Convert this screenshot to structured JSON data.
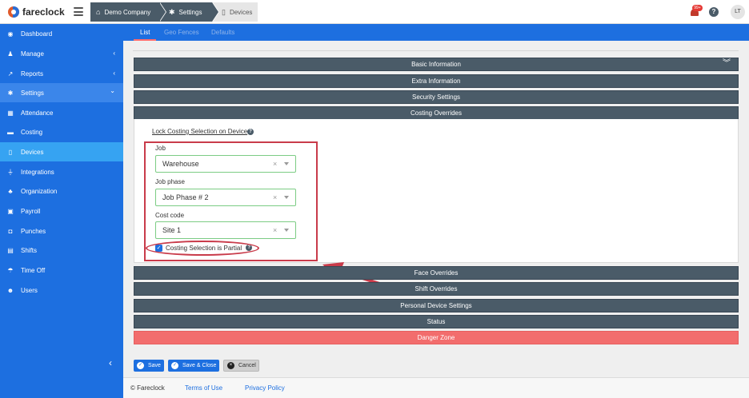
{
  "app": {
    "logo_text": "fareclock"
  },
  "breadcrumb": [
    {
      "label": "Demo Company",
      "icon": "home-icon"
    },
    {
      "label": "Settings",
      "icon": "gear-icon"
    },
    {
      "label": "Devices",
      "icon": "device-icon"
    }
  ],
  "header": {
    "notification_count": "99+",
    "help_icon": "?",
    "avatar_initials": "LT"
  },
  "sidebar": {
    "items": [
      {
        "label": "Dashboard",
        "icon": "dashboard-icon"
      },
      {
        "label": "Manage",
        "icon": "user-icon",
        "caret": "‹"
      },
      {
        "label": "Reports",
        "icon": "chart-icon",
        "caret": "‹"
      },
      {
        "label": "Settings",
        "icon": "gear-icon",
        "caret": "⌄"
      },
      {
        "label": "Attendance",
        "icon": "attendance-icon"
      },
      {
        "label": "Costing",
        "icon": "costing-icon"
      },
      {
        "label": "Devices",
        "icon": "device-icon"
      },
      {
        "label": "Integrations",
        "icon": "plug-icon"
      },
      {
        "label": "Organization",
        "icon": "org-icon"
      },
      {
        "label": "Payroll",
        "icon": "money-icon"
      },
      {
        "label": "Punches",
        "icon": "truck-icon"
      },
      {
        "label": "Shifts",
        "icon": "calendar-icon"
      },
      {
        "label": "Time Off",
        "icon": "umbrella-icon"
      },
      {
        "label": "Users",
        "icon": "users-icon"
      }
    ],
    "collapse_glyph": "‹"
  },
  "tabs": [
    {
      "label": "List"
    },
    {
      "label": "Geo Fences"
    },
    {
      "label": "Defaults"
    }
  ],
  "panels": {
    "basic": "Basic Information",
    "extra": "Extra Information",
    "security": "Security Settings",
    "costing": "Costing Overrides",
    "face": "Face Overrides",
    "shift": "Shift Overrides",
    "personal": "Personal Device Settings",
    "status": "Status",
    "danger": "Danger Zone"
  },
  "costing": {
    "lock_label": "Lock Costing Selection on Device",
    "job_label": "Job",
    "job_value": "Warehouse",
    "phase_label": "Job phase",
    "phase_value": "Job Phase # 2",
    "code_label": "Cost code",
    "code_value": "Site 1",
    "clear_glyph": "×",
    "partial_label": "Costing Selection is Partial",
    "partial_checked": true
  },
  "actions": {
    "save": "Save",
    "save_close": "Save & Close",
    "cancel": "Cancel"
  },
  "footer": {
    "copyright": "© Fareclock",
    "terms": "Terms of Use",
    "privacy": "Privacy Policy"
  },
  "colors": {
    "sidebar_bg": "#1d6fe0",
    "sidebar_active": "#36a3f2",
    "panel_header": "#4a5b68",
    "danger": "#f26d6d",
    "highlight": "#c93b4a",
    "select_border": "#7ccc84"
  }
}
